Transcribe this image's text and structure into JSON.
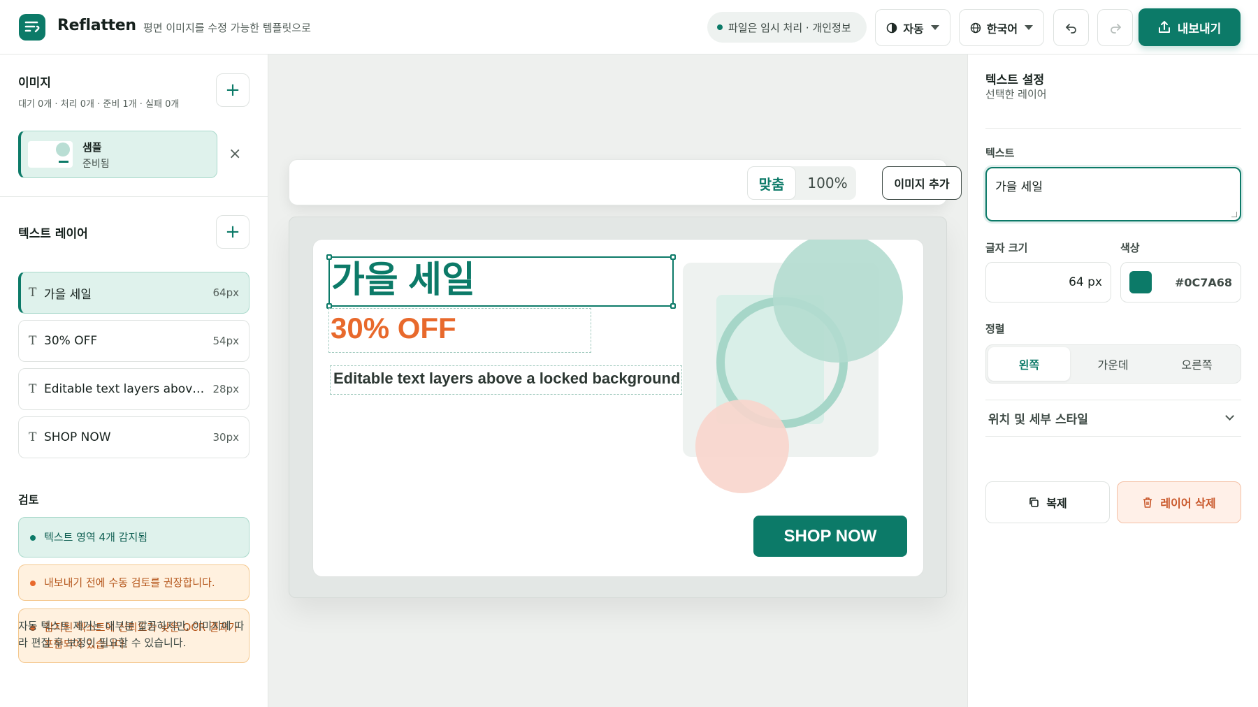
{
  "header": {
    "app_title": "Reflatten",
    "subtitle": "평면 이미지를 수정 가능한 템플릿으로",
    "privacy": "파일은 임시 처리 · 개인정보",
    "theme": "자동",
    "language": "한국어",
    "export": "내보내기",
    "icons": [
      "logo-icon",
      "contrast-icon",
      "globe-icon",
      "undo-icon",
      "redo-icon",
      "upload-icon"
    ]
  },
  "images": {
    "title": "이미지",
    "meta": "대기 0개 · 처리 0개 · 준비 1개 · 실패 0개",
    "add": "+",
    "item": {
      "name": "샘플",
      "status": "준비됨",
      "remove": "×"
    }
  },
  "layers": {
    "title": "텍스트 레이어",
    "add": "+",
    "type_glyph": "T",
    "items": [
      {
        "label": "가을 세일",
        "size": "64px"
      },
      {
        "label": "30% OFF",
        "size": "54px"
      },
      {
        "label": "Editable text layers above a locked background",
        "size": "28px"
      },
      {
        "label": "SHOP NOW",
        "size": "30px"
      }
    ]
  },
  "review": {
    "title": "검토",
    "items": [
      {
        "text": "텍스트 영역 4개 감지됨",
        "level": "ok"
      },
      {
        "text": "내보내기 전에 수동 검토를 권장합니다.",
        "level": "warn"
      },
      {
        "text": "감지된 텍스트에 신뢰도가 낮은 OCR 결과가 포함되어 있습니다.",
        "level": "warn"
      }
    ],
    "note": "자동 텍스트 제거는 대부분 깔끔하지만, 이미지에 따라 편집 후 보정이 필요할 수 있습니다."
  },
  "canvas": {
    "fit": "맞춤",
    "zoom": "100%",
    "add_image": "이미지 추가",
    "title": "가을 세일",
    "discount": "30% OFF",
    "subtitle": "Editable text layers above a locked background",
    "cta": "SHOP NOW",
    "colors": {
      "brand": "#0C7A68",
      "accent": "#E8692C"
    }
  },
  "settings": {
    "title": "텍스트 설정",
    "subtitle": "선택한 레이어",
    "text_label": "텍스트",
    "text_value": "가을 세일",
    "size_label": "글자 크기",
    "size_value": "64 px",
    "color_label": "색상",
    "color_value": "#0C7A68",
    "align_label": "정렬",
    "align_options": [
      "왼쪽",
      "가운데",
      "오른쪽"
    ],
    "align_selected": "왼쪽",
    "advanced": "위치 및 세부 스타일",
    "duplicate": "복제",
    "delete": "레이어 삭제"
  }
}
